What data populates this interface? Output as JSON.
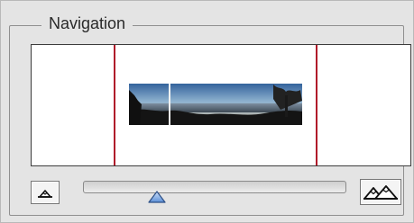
{
  "panel": {
    "title": "Navigation"
  },
  "zoom": {
    "slider_level": 0.28,
    "zoom_out_icon": "small-mountain-icon",
    "zoom_in_icon": "large-mountains-icon"
  },
  "colors": {
    "view_box_lines": "#b0192a",
    "slider_thumb": "#5b8fd6"
  }
}
